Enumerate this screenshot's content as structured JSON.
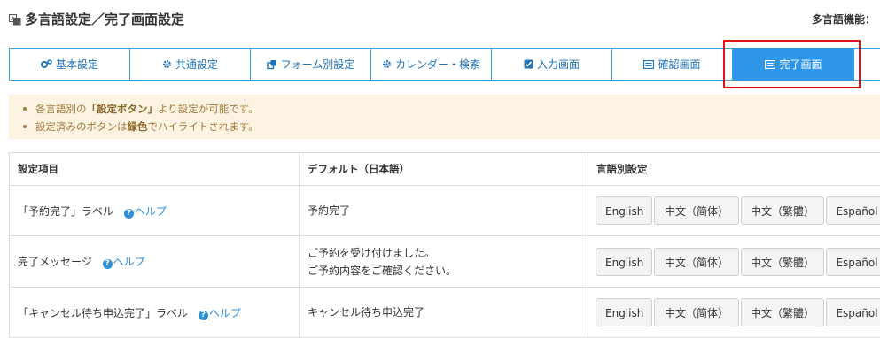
{
  "header": {
    "title": "多言語設定／完了画面設定",
    "title_icon": "language-icon",
    "lang_function_label": "多言語機能："
  },
  "tabs": [
    {
      "label": "基本設定",
      "icon": "gears-icon"
    },
    {
      "label": "共通設定",
      "icon": "gear-icon"
    },
    {
      "label": "フォーム別設定",
      "icon": "copy-icon"
    },
    {
      "label": "カレンダー・検索",
      "icon": "gear-icon"
    },
    {
      "label": "入力画面",
      "icon": "checkbox-icon"
    },
    {
      "label": "確認画面",
      "icon": "list-icon"
    },
    {
      "label": "完了画面",
      "icon": "list-icon",
      "active": true
    }
  ],
  "notice": {
    "line1_pre": "各言語別の",
    "line1_bold": "「設定ボタン」",
    "line1_post": "より設定が可能です。",
    "line2_pre": "設定済みのボタンは",
    "line2_bold": "緑色",
    "line2_post": "でハイライトされます。"
  },
  "table": {
    "headers": [
      "設定項目",
      "デフォルト（日本語）",
      "言語別設定"
    ],
    "help_label": "ヘルプ",
    "rows": [
      {
        "item": "「予約完了」ラベル",
        "default_line1": "予約完了",
        "default_line2": ""
      },
      {
        "item": "完了メッセージ",
        "default_line1": "ご予約を受け付けました。",
        "default_line2": "ご予約内容をご確認ください。"
      },
      {
        "item": "「キャンセル待ち申込完了」ラベル",
        "default_line1": "キャンセル待ち申込完了",
        "default_line2": ""
      }
    ],
    "language_buttons": [
      "English",
      "中文（简体）",
      "中文（繁體）",
      "Español"
    ]
  },
  "colors": {
    "accent": "#2f97e8",
    "tab_border": "#3aa0e6",
    "highlight": "#e0121b",
    "notice_bg": "#fcf3e2",
    "notice_text": "#a07b3b",
    "help_link": "#2f8fd8"
  }
}
